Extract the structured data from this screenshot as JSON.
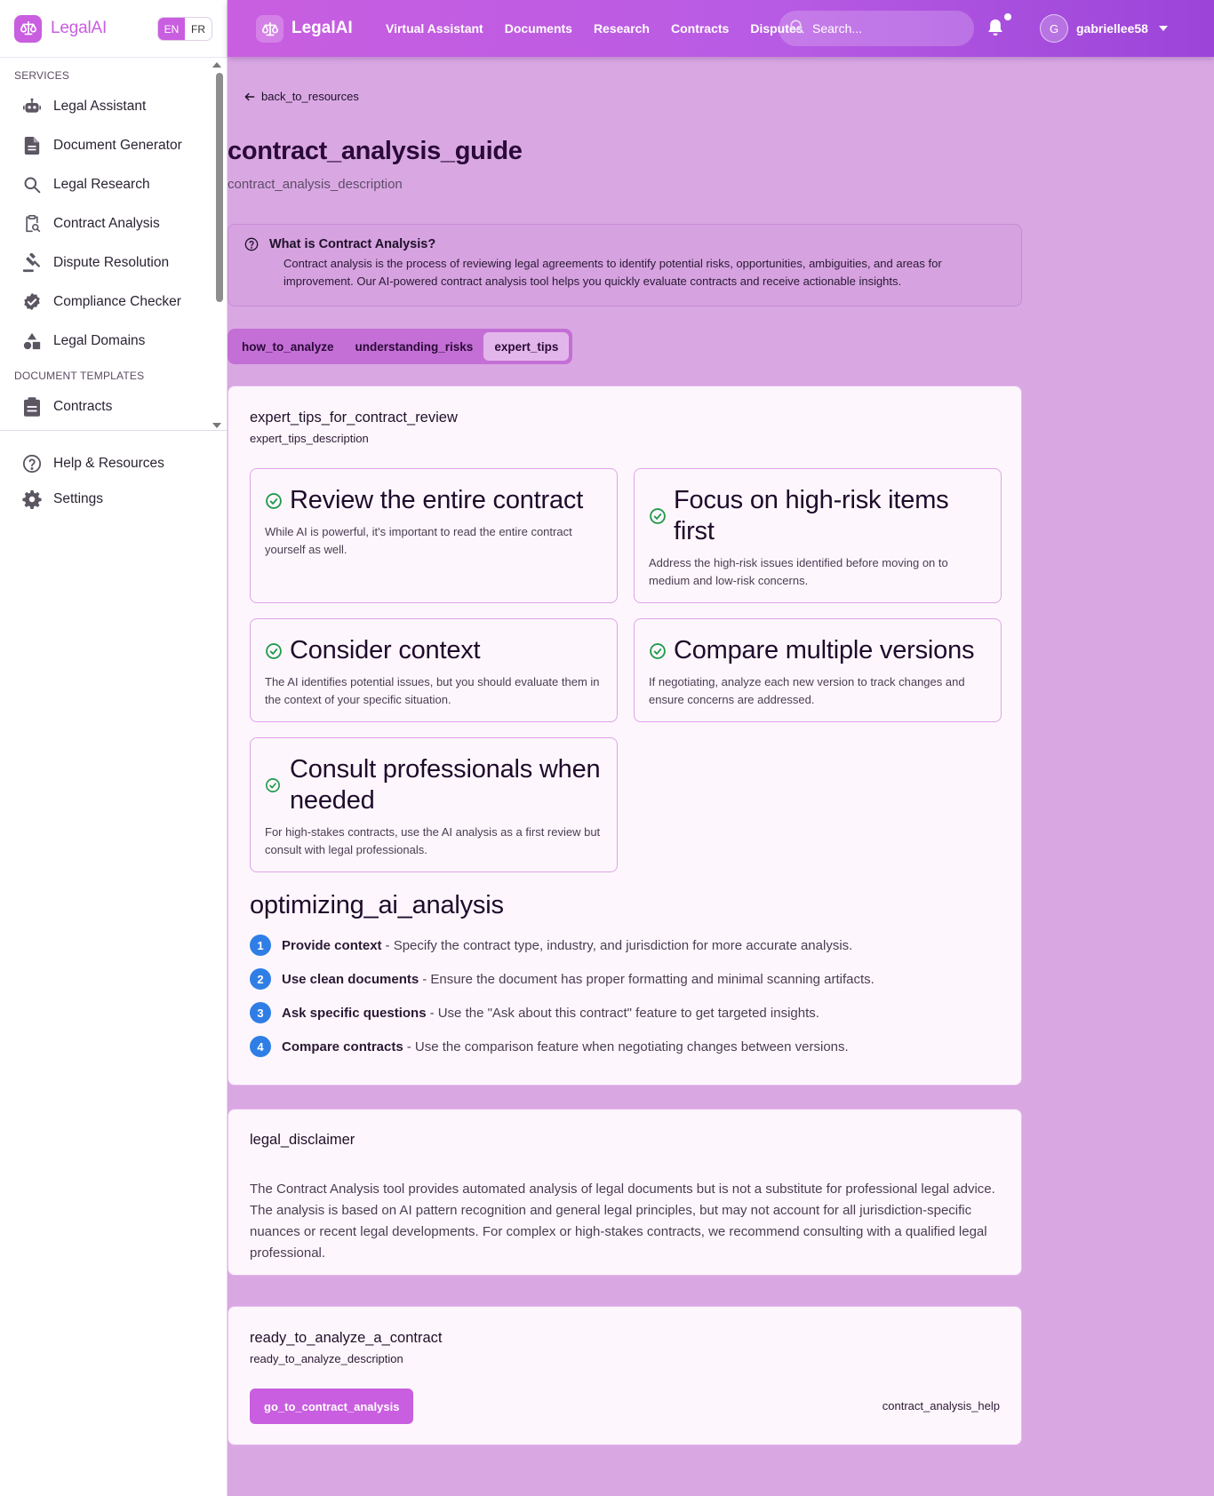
{
  "colors": {
    "brand": "#c95ee0",
    "background": "#d9a8e3",
    "step_badge": "#2f7ee6",
    "check": "#1f9a4a"
  },
  "sidebar": {
    "brand": "LegalAI",
    "lang": {
      "en": "EN",
      "fr": "FR",
      "active": "EN"
    },
    "sections": {
      "services": "SERVICES",
      "document_templates": "DOCUMENT TEMPLATES"
    },
    "items": [
      {
        "label": "Legal Assistant",
        "icon": "robot-icon"
      },
      {
        "label": "Document Generator",
        "icon": "document-icon"
      },
      {
        "label": "Legal Research",
        "icon": "search-icon"
      },
      {
        "label": "Contract Analysis",
        "icon": "clipboard-search-icon"
      },
      {
        "label": "Dispute Resolution",
        "icon": "gavel-icon"
      },
      {
        "label": "Compliance Checker",
        "icon": "badge-check-icon"
      },
      {
        "label": "Legal Domains",
        "icon": "shapes-icon"
      }
    ],
    "templates": [
      {
        "label": "Contracts",
        "icon": "clipboard-icon"
      }
    ],
    "bottom": [
      {
        "label": "Help & Resources",
        "icon": "help-circle-icon"
      },
      {
        "label": "Settings",
        "icon": "gear-icon"
      }
    ]
  },
  "topbar": {
    "brand": "LegalAI",
    "nav": [
      "Virtual Assistant",
      "Documents",
      "Research",
      "Contracts",
      "Disputes"
    ],
    "search_placeholder": "Search...",
    "user": {
      "initial": "G",
      "name": "gabriellee58"
    }
  },
  "page": {
    "back_label": "back_to_resources",
    "title": "contract_analysis_guide",
    "description": "contract_analysis_description",
    "info": {
      "title": "What is Contract Analysis?",
      "text": "Contract analysis is the process of reviewing legal agreements to identify potential risks, opportunities, ambiguities, and areas for improvement. Our AI-powered contract analysis tool helps you quickly evaluate contracts and receive actionable insights."
    },
    "tabs": [
      {
        "label": "how_to_analyze",
        "active": false
      },
      {
        "label": "understanding_risks",
        "active": false
      },
      {
        "label": "expert_tips",
        "active": true
      }
    ],
    "tips_card": {
      "title": "expert_tips_for_contract_review",
      "subtitle": "expert_tips_description",
      "tips": [
        {
          "title": "Review the entire contract",
          "text": "While AI is powerful, it's important to read the entire contract yourself as well."
        },
        {
          "title": "Focus on high-risk items first",
          "text": "Address the high-risk issues identified before moving on to medium and low-risk concerns."
        },
        {
          "title": "Consider context",
          "text": "The AI identifies potential issues, but you should evaluate them in the context of your specific situation."
        },
        {
          "title": "Compare multiple versions",
          "text": "If negotiating, analyze each new version to track changes and ensure concerns are addressed."
        },
        {
          "title": "Consult professionals when needed",
          "text": "For high-stakes contracts, use the AI analysis as a first review but consult with legal professionals."
        }
      ],
      "optimizing_title": "optimizing_ai_analysis",
      "steps": [
        {
          "num": "1",
          "bold": "Provide context",
          "text": "- Specify the contract type, industry, and jurisdiction for more accurate analysis."
        },
        {
          "num": "2",
          "bold": "Use clean documents",
          "text": "- Ensure the document has proper formatting and minimal scanning artifacts."
        },
        {
          "num": "3",
          "bold": "Ask specific questions",
          "text": "- Use the \"Ask about this contract\" feature to get targeted insights."
        },
        {
          "num": "4",
          "bold": "Compare contracts",
          "text": "- Use the comparison feature when negotiating changes between versions."
        }
      ]
    },
    "disclaimer": {
      "title": "legal_disclaimer",
      "text": "The Contract Analysis tool provides automated analysis of legal documents but is not a substitute for professional legal advice. The analysis is based on AI pattern recognition and general legal principles, but may not account for all jurisdiction-specific nuances or recent legal developments. For complex or high-stakes contracts, we recommend consulting with a qualified legal professional."
    },
    "cta": {
      "title": "ready_to_analyze_a_contract",
      "subtitle": "ready_to_analyze_description",
      "button": "go_to_contract_analysis",
      "help": "contract_analysis_help"
    }
  }
}
